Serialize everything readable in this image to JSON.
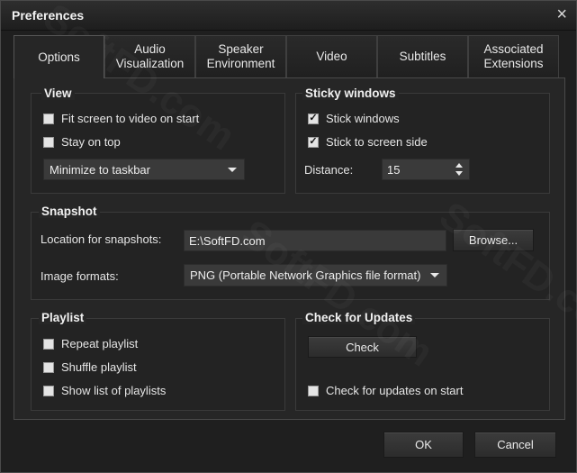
{
  "window": {
    "title": "Preferences"
  },
  "tabs": [
    {
      "label": "Options"
    },
    {
      "label": "Audio\nVisualization"
    },
    {
      "label": "Speaker\nEnvironment"
    },
    {
      "label": "Video"
    },
    {
      "label": "Subtitles"
    },
    {
      "label": "Associated\nExtensions"
    }
  ],
  "active_tab": "Options",
  "view": {
    "title": "View",
    "fit_screen": {
      "label": "Fit screen to video on start",
      "checked": false
    },
    "stay_on_top": {
      "label": "Stay on top",
      "checked": false
    },
    "minimize_option": "Minimize to taskbar"
  },
  "sticky": {
    "title": "Sticky windows",
    "stick_windows": {
      "label": "Stick windows",
      "checked": true
    },
    "stick_to_screen_side": {
      "label": "Stick to screen side",
      "checked": true
    },
    "distance_label": "Distance:",
    "distance_value": "15"
  },
  "snapshot": {
    "title": "Snapshot",
    "location_label": "Location for snapshots:",
    "location_value": "E:\\SoftFD.com",
    "browse_label": "Browse...",
    "formats_label": "Image formats:",
    "format_value": "PNG (Portable Network Graphics file format)"
  },
  "playlist": {
    "title": "Playlist",
    "repeat": {
      "label": "Repeat playlist",
      "checked": false
    },
    "shuffle": {
      "label": "Shuffle playlist",
      "checked": false
    },
    "show_list": {
      "label": "Show list of playlists",
      "checked": false
    }
  },
  "updates": {
    "title": "Check for Updates",
    "check_label": "Check",
    "on_start": {
      "label": "Check for updates on start",
      "checked": false
    }
  },
  "footer": {
    "ok_label": "OK",
    "cancel_label": "Cancel"
  },
  "watermark_text": "SoftFD.com",
  "check_glyph": "✓",
  "close_glyph": "×"
}
